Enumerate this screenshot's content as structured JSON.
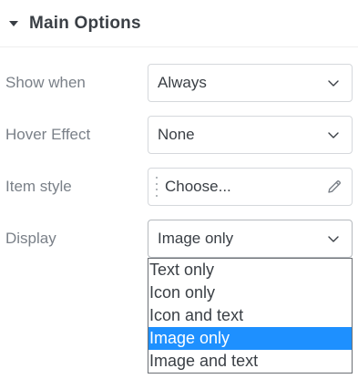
{
  "section": {
    "title": "Main Options",
    "expanded": true
  },
  "fields": {
    "show_when": {
      "label": "Show when",
      "value": "Always"
    },
    "hover_effect": {
      "label": "Hover Effect",
      "value": "None"
    },
    "item_style": {
      "label": "Item style",
      "value": "Choose..."
    },
    "display": {
      "label": "Display",
      "value": "Image only",
      "options": [
        "Text only",
        "Icon only",
        "Icon and text",
        "Image only",
        "Image and text"
      ],
      "selected_index": 3
    }
  },
  "icons": {
    "section_toggle": "caret-down-icon",
    "select_arrow": "chevron-down-icon",
    "edit": "pencil-icon",
    "drag": "drag-handle-icon"
  },
  "colors": {
    "label_text": "#7a8088",
    "value_text": "#3a3f45",
    "selected_option_bg": "#1e90ff",
    "selected_option_text": "#ffffff",
    "border": "#d5d8dc"
  }
}
